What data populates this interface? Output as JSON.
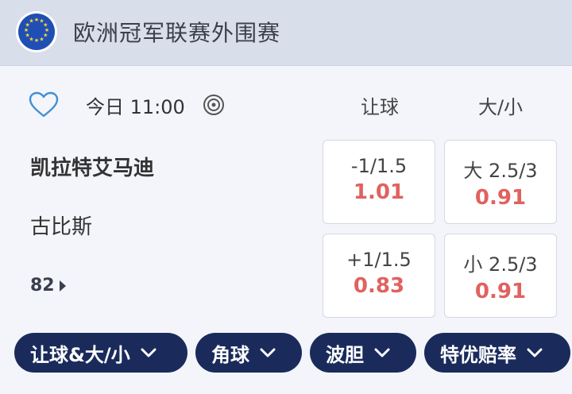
{
  "league": {
    "name": "欧洲冠军联赛外围赛",
    "flag_icon": "eu-flag-icon"
  },
  "match": {
    "time": "今日 11:00",
    "home_team": "凯拉特艾马迪",
    "away_team": "古比斯",
    "more_markets_count": "82"
  },
  "columns": {
    "handicap": "让球",
    "over_under": "大/小"
  },
  "odds": {
    "home_handicap": {
      "line": "-1/1.5",
      "price": "1.01"
    },
    "over": {
      "line": "大 2.5/3",
      "price": "0.91"
    },
    "away_handicap": {
      "line": "+1/1.5",
      "price": "0.83"
    },
    "under": {
      "line": "小 2.5/3",
      "price": "0.91"
    }
  },
  "tabs": [
    {
      "label": "让球&大/小"
    },
    {
      "label": "角球"
    },
    {
      "label": "波胆"
    },
    {
      "label": "特优赔率"
    }
  ],
  "colors": {
    "header_bg": "#d8deea",
    "price": "#e0625f",
    "pill_bg": "#1a2b5b",
    "heart": "#3f8fd6"
  }
}
